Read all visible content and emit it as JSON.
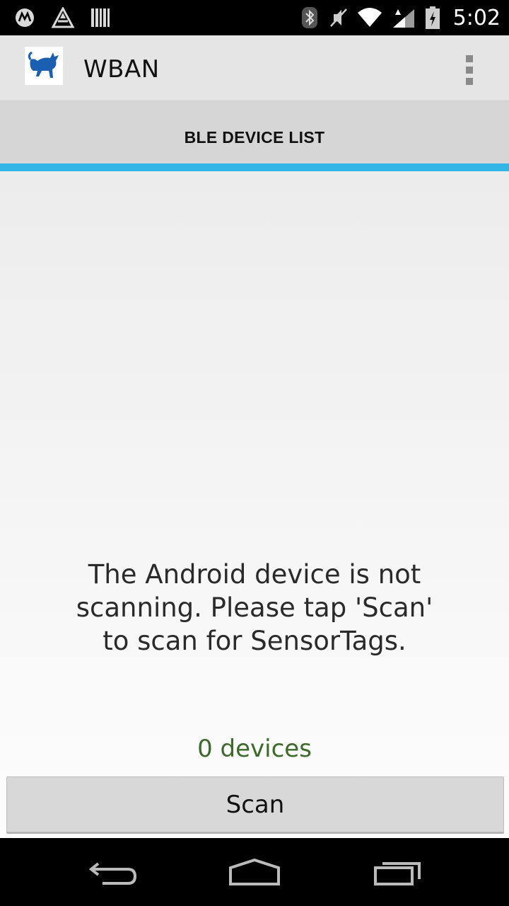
{
  "status_bar": {
    "time": "5:02",
    "left_icons": [
      "motorola-icon",
      "drive-icon",
      "barcode-icon"
    ],
    "right_icons": [
      "bluetooth-icon",
      "mute-icon",
      "wifi-icon",
      "signal-icon",
      "battery-icon"
    ]
  },
  "action_bar": {
    "title": "WBAN",
    "app_icon": "cat-logo-icon",
    "overflow_icon": "overflow-menu-icon"
  },
  "tabs": [
    {
      "label": "BLE DEVICE LIST",
      "selected": true
    }
  ],
  "colors": {
    "tab_indicator": "#33b5e5",
    "device_count": "#3b6a2a"
  },
  "main": {
    "status_message": "The Android device is not scanning. Please tap 'Scan' to scan for SensorTags.",
    "device_count": "0 devices",
    "scan_button_label": "Scan"
  },
  "nav_bar": {
    "icons": [
      "back-icon",
      "home-icon",
      "recents-icon"
    ]
  }
}
